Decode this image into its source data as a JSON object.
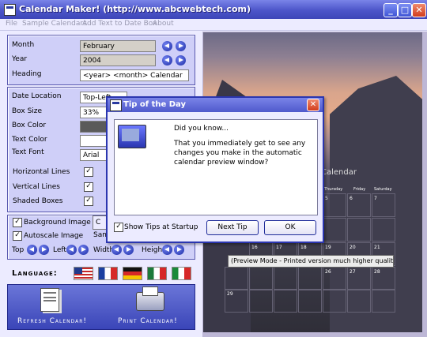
{
  "window": {
    "title": "Calendar Maker! (http://www.abcwebtech.com)"
  },
  "menu": [
    "File",
    "Sample Calendars",
    "Add Text to Date Box",
    "About"
  ],
  "calendar_settings": {
    "month_label": "Month",
    "month_value": "February",
    "year_label": "Year",
    "year_value": "2004",
    "heading_label": "Heading",
    "heading_value": "<year> <month> Calendar"
  },
  "style_settings": {
    "date_location_label": "Date Location",
    "date_location_value": "Top-Left",
    "box_size_label": "Box Size",
    "box_size_value": "33%",
    "box_color_label": "Box Color",
    "text_color_label": "Text Color",
    "text_font_label": "Text Font",
    "text_font_value": "Arial",
    "horizontal_lines_label": "Horizontal Lines",
    "horizontal_lines_checked": true,
    "vertical_lines_label": "Vertical Lines",
    "vertical_lines_checked": true,
    "shaded_boxes_label": "Shaded Boxes",
    "shaded_boxes_checked": true,
    "box_color": "#5a5a5a"
  },
  "image_settings": {
    "background_image_label": "Background Image",
    "background_image_checked": true,
    "autoscale_label": "Autoscale Image",
    "autoscale_checked": true,
    "change_button_partial": "C",
    "sample_partial": "Sam",
    "top_label": "Top",
    "left_label": "Left",
    "width_label": "Width",
    "height_label": "Height"
  },
  "language": {
    "label": "Language:",
    "flags": [
      "us-flag",
      "fr-flag",
      "de-flag",
      "mx-flag",
      "it-flag"
    ]
  },
  "actions": {
    "refresh_label": "Refresh Calendar!",
    "print_label": "Print Calendar!"
  },
  "preview": {
    "heading_partial": "Calendar",
    "weekdays": [
      "Thursday",
      "Friday",
      "Saturday"
    ],
    "row1": [
      "5",
      "6",
      "7"
    ],
    "row4": [
      "16",
      "17",
      "18",
      "19",
      "20",
      "21"
    ],
    "row5": [
      "26",
      "27",
      "28"
    ],
    "row6_first": "29",
    "tooltip": "(Preview Mode - Printed version much higher quality)"
  },
  "tip_dialog": {
    "title": "Tip of the Day",
    "did_you_know": "Did you know...",
    "tip_text": "That you immediately get to see any changes you make in the automatic calendar preview window?",
    "show_tips_label": "Show Tips at Startup",
    "show_tips_checked": true,
    "next_tip_label": "Next Tip",
    "ok_label": "OK"
  },
  "colors": {
    "titlebar": "#4c55c9",
    "panel": "#cfcff8",
    "accent": "#2b36b0"
  }
}
